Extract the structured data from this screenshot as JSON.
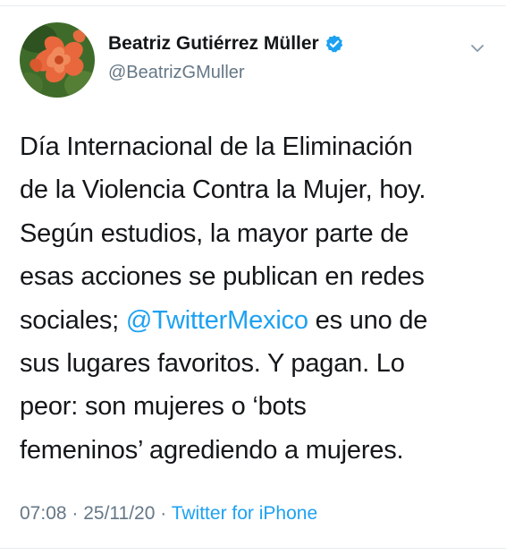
{
  "tweet": {
    "author": {
      "name": "Beatriz Gutiérrez Müller",
      "handle": "@BeatrizGMuller",
      "verified": true,
      "avatar_icon": "flower-avatar"
    },
    "text_lines": [
      "Día Internacional de la Eliminación",
      "de la Violencia Contra la Mujer, hoy.",
      "Según estudios, la mayor parte de",
      "esas acciones se publican en redes",
      {
        "before": "sociales; ",
        "mention": "@TwitterMexico",
        "after": " es uno de"
      },
      "sus lugares favoritos. Y pagan. Lo",
      "peor: son mujeres o ‘bots",
      "femeninos’ agrediendo a mujeres."
    ],
    "time": "07:08",
    "date": "25/11/20",
    "separator": " · ",
    "source": "Twitter for iPhone"
  },
  "colors": {
    "link": "#1da1f2",
    "secondary_text": "#657786",
    "primary_text": "#14171a",
    "verified_badge": "#1da1f2"
  },
  "icons": {
    "verified": "verified-badge-icon",
    "more": "chevron-down-icon"
  }
}
